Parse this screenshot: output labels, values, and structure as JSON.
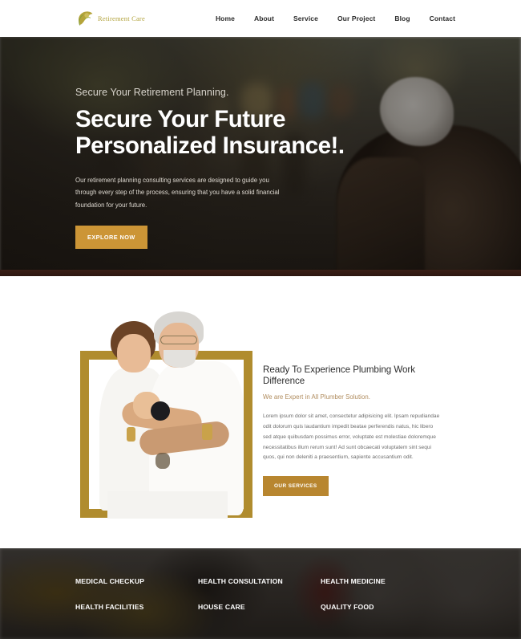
{
  "header": {
    "logo_text": "Retirement Care",
    "logo_icon": "leaf-care-icon",
    "nav": [
      {
        "label": "Home"
      },
      {
        "label": "About"
      },
      {
        "label": "Service"
      },
      {
        "label": "Our Project"
      },
      {
        "label": "Blog"
      },
      {
        "label": "Contact"
      }
    ]
  },
  "hero": {
    "eyebrow": "Secure Your Retirement Planning.",
    "title": "Secure Your Future Personalized Insurance!.",
    "description": "Our retirement planning consulting services are designed to guide you through every step of the process, ensuring that you have a solid financial foundation for your future.",
    "cta_label": "EXPLORE NOW",
    "cta_color": "#cc9536",
    "image_alt": "elderly-man-outdoors-photo"
  },
  "about": {
    "heading": "Ready To Experience Plumbing Work Difference",
    "subheading": "We are Expert in All Plumber Solution.",
    "subheading_color": "#b08c5e",
    "paragraph": "Lorem ipsum dolor sit amet, consectetur adipisicing elit. Ipsam repudiandae odit dolorum quis laudantium impedit beatae perferendis natus, hic libero sed atque quibusdam possimus error, voluptate est molestiae doloremque necessitatibus illum rerum sunt! Ad sunt obcaecati voluptatem sint sequi quos, qui non deleniti a praesentium, sapiente accusantium odit.",
    "cta_label": "OUR SERVICES",
    "cta_color": "#b8862f",
    "frame_color": "#b08c2e",
    "image_alt": "elderly-couple-embracing-photo"
  },
  "services": {
    "items": [
      {
        "label": "MEDICAL CHECKUP"
      },
      {
        "label": "HEALTH CONSULTATION"
      },
      {
        "label": "HEALTH MEDICINE"
      },
      {
        "label": "HEALTH FACILITIES"
      },
      {
        "label": "HOUSE CARE"
      },
      {
        "label": "QUALITY FOOD"
      }
    ],
    "background_alt": "plumber-working-photo"
  }
}
